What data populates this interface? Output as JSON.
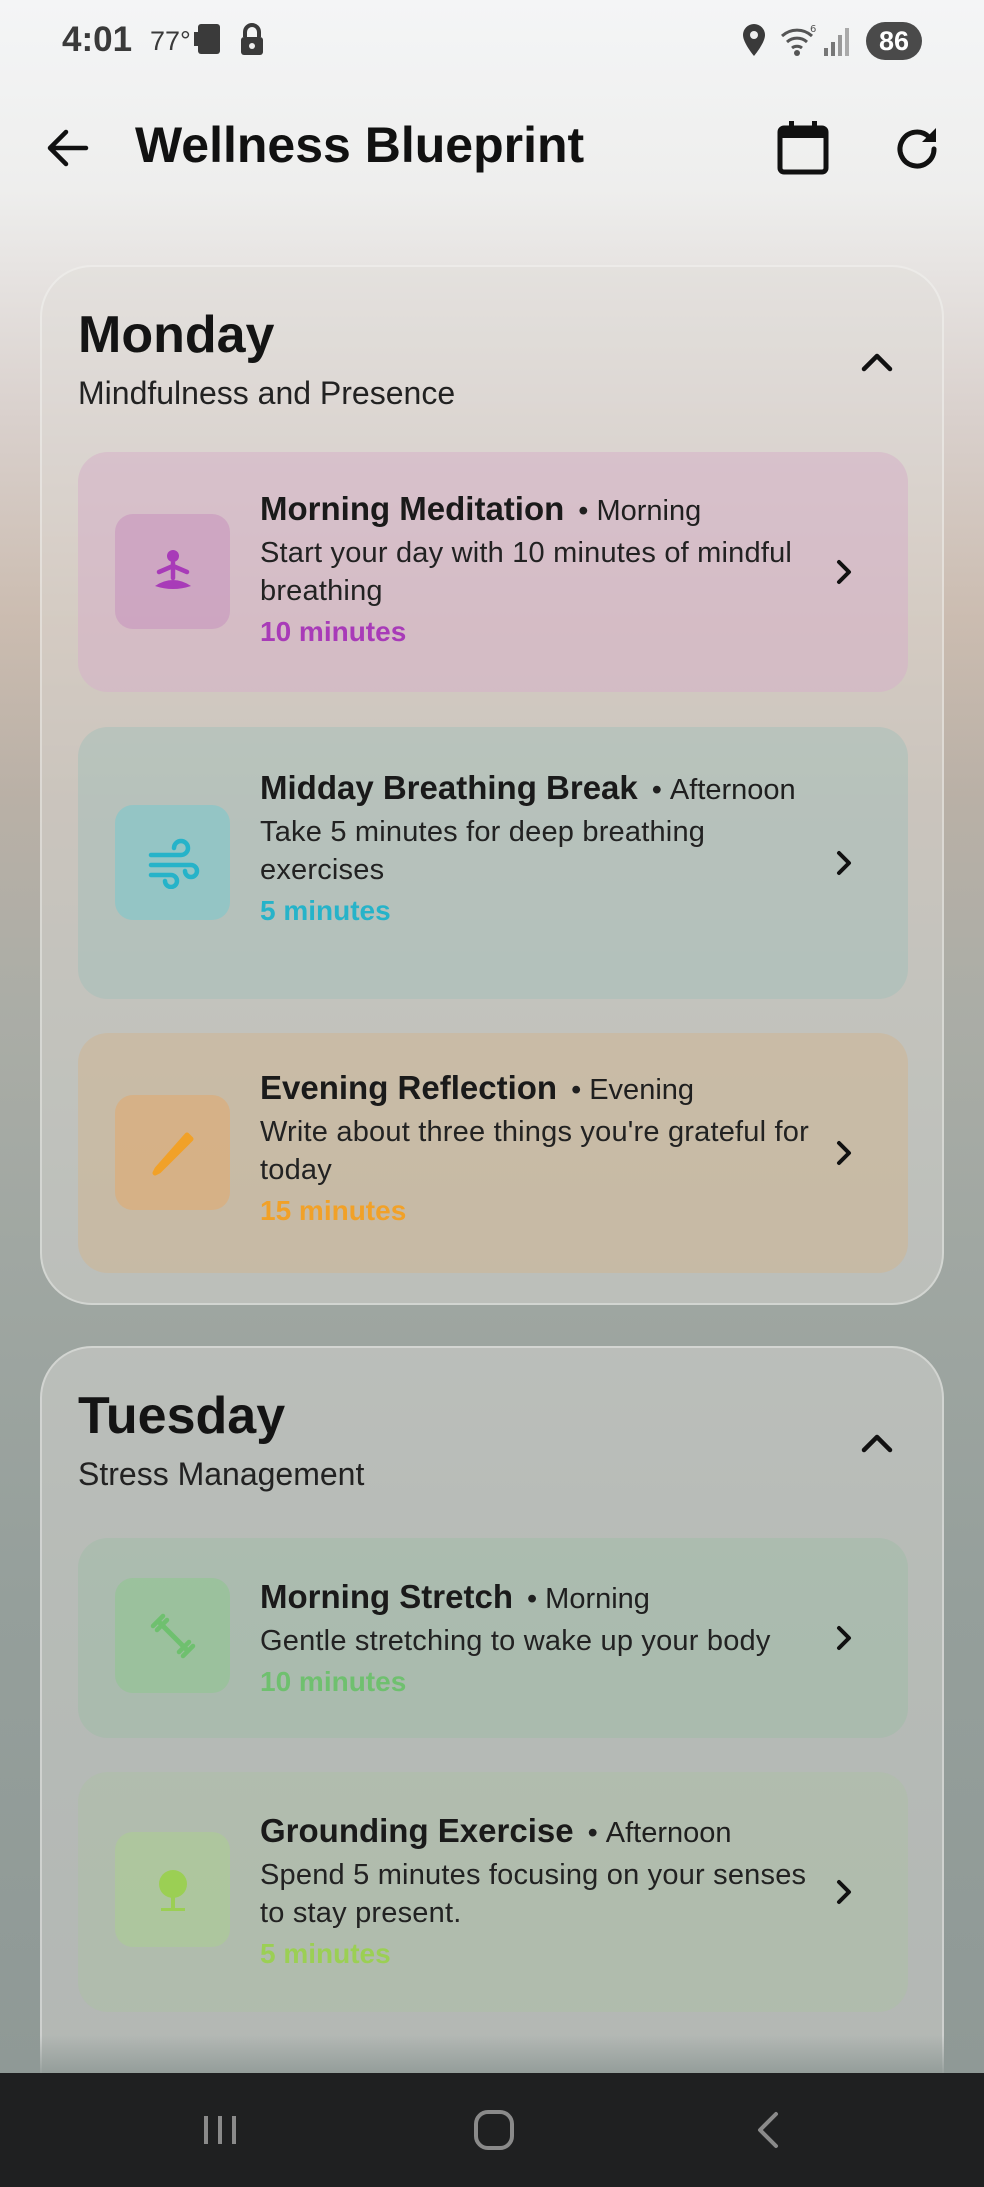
{
  "status_bar": {
    "time": "4:01",
    "temperature": "77°",
    "battery": "86"
  },
  "app_bar": {
    "title": "Wellness Blueprint"
  },
  "days": [
    {
      "name": "Monday",
      "theme": "Mindfulness and Presence",
      "activities": [
        {
          "name": "Morning Meditation",
          "time": "Morning",
          "description": "Start your day with 10 minutes of mindful breathing",
          "duration": "10 minutes",
          "icon": "meditation-icon",
          "color": "#a83bb8"
        },
        {
          "name": "Midday Breathing Break",
          "time": "Afternoon",
          "description": "Take 5 minutes for deep breathing exercises",
          "duration": "5 minutes",
          "icon": "wind-icon",
          "color": "#26b3c9"
        },
        {
          "name": "Evening Reflection",
          "time": "Evening",
          "description": "Write about three things you're grateful for today",
          "duration": "15 minutes",
          "icon": "pencil-icon",
          "color": "#f1a128"
        }
      ]
    },
    {
      "name": "Tuesday",
      "theme": "Stress Management",
      "activities": [
        {
          "name": "Morning Stretch",
          "time": "Morning",
          "description": "Gentle stretching to wake up your body",
          "duration": "10 minutes",
          "icon": "stretch-icon",
          "color": "#6fc06f"
        },
        {
          "name": "Grounding Exercise",
          "time": "Afternoon",
          "description": "Spend 5 minutes focusing on your senses to stay present.",
          "duration": "5 minutes",
          "icon": "tree-icon",
          "color": "#9bcf54"
        }
      ]
    }
  ]
}
